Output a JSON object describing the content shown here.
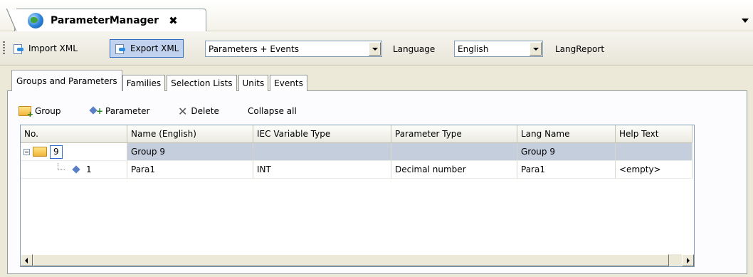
{
  "window": {
    "tab_title": "ParameterManager",
    "close_glyph": "✖"
  },
  "toolbar": {
    "import_label": "Import XML",
    "export_label": "Export XML",
    "filter_value": "Parameters + Events",
    "language_label": "Language",
    "language_value": "English",
    "langreport_label": "LangReport"
  },
  "tabs": [
    {
      "label": "Groups and Parameters",
      "active": true
    },
    {
      "label": "Families"
    },
    {
      "label": "Selection Lists"
    },
    {
      "label": "Units"
    },
    {
      "label": "Events"
    }
  ],
  "subtoolbar": {
    "group_label": "Group",
    "parameter_label": "Parameter",
    "delete_label": "Delete",
    "collapse_label": "Collapse all"
  },
  "grid": {
    "columns": [
      "No.",
      "Name (English)",
      "IEC Variable Type",
      "Parameter Type",
      "Lang Name",
      "Help Text"
    ],
    "rows": [
      {
        "no": "9",
        "name": "Group 9",
        "iec": "",
        "ptype": "",
        "lang": "Group 9",
        "help": "",
        "selected": true,
        "kind": "group"
      },
      {
        "no": "1",
        "name": "Para1",
        "iec": "INT",
        "ptype": "Decimal number",
        "lang": "Para1",
        "help": "<empty>",
        "kind": "parameter"
      }
    ]
  },
  "icons": {
    "tab_icon": "globe-icon",
    "import_icon": "xml-import-icon",
    "export_icon": "xml-export-icon",
    "group_icon": "folder-add-icon",
    "parameter_icon": "parameter-add-icon",
    "delete_icon": "delete-x-icon"
  }
}
